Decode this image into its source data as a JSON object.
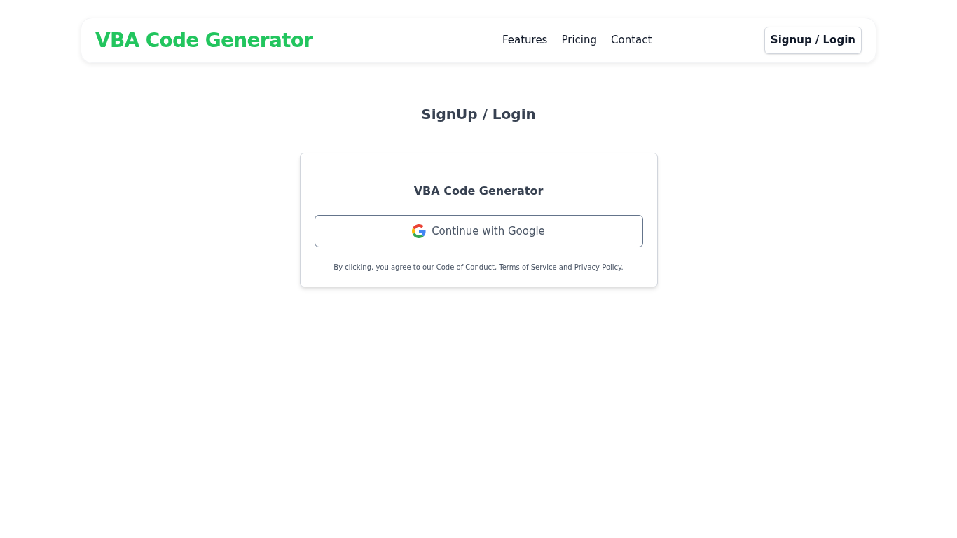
{
  "header": {
    "logo": "VBA Code Generator",
    "nav": [
      "Features",
      "Pricing",
      "Contact"
    ],
    "action": "Signup / Login"
  },
  "page_title": "SignUp / Login",
  "card": {
    "title": "VBA Code Generator",
    "google_button": "Continue with Google",
    "terms": "By clicking, you agree to our Code of Conduct, Terms of Service and Privacy Policy."
  }
}
